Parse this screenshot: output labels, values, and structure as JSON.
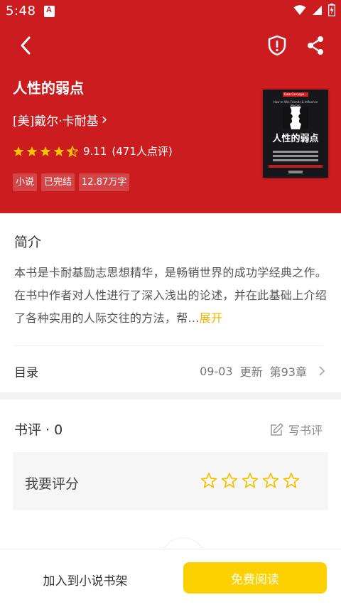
{
  "status_bar": {
    "time": "5:48",
    "notification_icon": "a-notification-icon"
  },
  "nav": {
    "back_icon": "chevron-left-icon",
    "report_icon": "shield-alert-icon",
    "share_icon": "share-icon"
  },
  "book": {
    "title": "人性的弱点",
    "author": "[美]戴尔·卡耐基",
    "author_arrow": "›",
    "rating_stars": 4.5,
    "rating": "9.11",
    "rating_count": "(471人点评)",
    "tags": [
      "小说",
      "已完结",
      "12.87万字"
    ],
    "cover": {
      "band_text": "Dale Carnegie",
      "subtitle": "How to Win Friends & Influence People",
      "title": "人性的弱点"
    }
  },
  "intro": {
    "title": "简介",
    "text": "本书是卡耐基励志思想精华，是畅销世界的成功学经典之作。在书中作者对人性进行了深入浅出的论述，并在此基础上介绍了各种实用的人际交往的方法，帮...",
    "expand": "展开"
  },
  "catalog": {
    "label": "目录",
    "date": "09-03",
    "update": "更新",
    "chapter": "第93章"
  },
  "reviews": {
    "title": "书评 · 0",
    "write_label": "写书评",
    "rate_label": "我要评分",
    "star_count": 5
  },
  "bottom": {
    "add_shelf": "加入到小说书架",
    "read": "免费阅读"
  },
  "colors": {
    "header_red": "#cb1d20",
    "accent_yellow": "#fdd000",
    "star_yellow": "#f5c400"
  }
}
